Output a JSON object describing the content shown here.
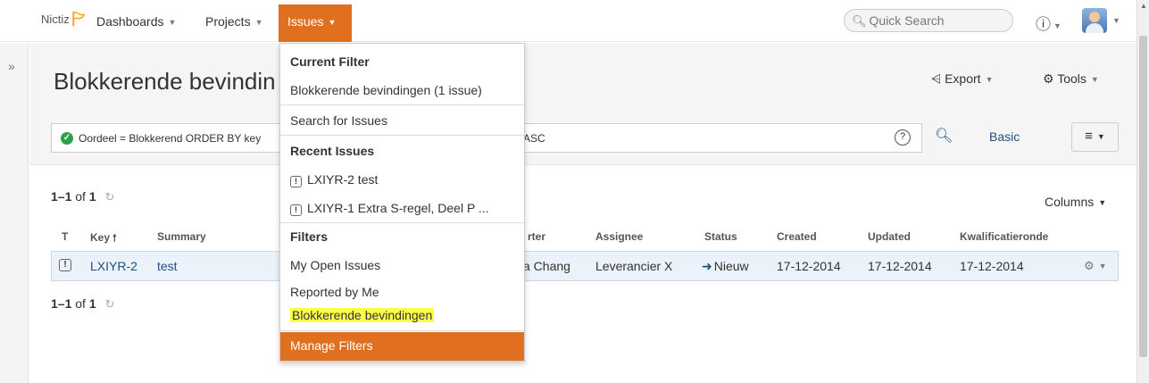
{
  "topbar": {
    "logo": "Nictiz",
    "nav": [
      {
        "label": "Dashboards"
      },
      {
        "label": "Projects"
      },
      {
        "label": "Issues"
      }
    ],
    "quick_search_placeholder": "Quick Search",
    "help_icon": "help-icon",
    "avatar_icon": "user-avatar"
  },
  "page": {
    "title": "Blokkerende bevindin",
    "export_label": "Export",
    "tools_label": "Tools"
  },
  "search": {
    "query_left": "Oordeel = Blokkerend ORDER BY key",
    "query_right": "ASC",
    "basic_label": "Basic"
  },
  "results": {
    "count_range": "1–1",
    "count_of": "of",
    "count_total": "1",
    "columns_label": "Columns",
    "headers": [
      "T",
      "Key",
      "Summary",
      "rter",
      "Assignee",
      "Status",
      "Created",
      "Updated",
      "Kwalificatieronde"
    ],
    "rows": [
      {
        "type": "!",
        "key": "LXIYR-2",
        "summary": "test",
        "reporter": "a Chang",
        "assignee": "Leverancier X",
        "status": "Nieuw",
        "created": "17-12-2014",
        "updated": "17-12-2014",
        "kwalificatieronde": "17-12-2014"
      }
    ]
  },
  "dropdown": {
    "current_filter_heading": "Current Filter",
    "current_filter_item": "Blokkerende bevindingen (1 issue)",
    "search_item": "Search for Issues",
    "recent_heading": "Recent Issues",
    "recent_items": [
      "LXIYR-2 test",
      "LXIYR-1 Extra S-regel, Deel P ..."
    ],
    "filters_heading": "Filters",
    "filter_items": [
      "My Open Issues",
      "Reported by Me",
      "Blokkerende bevindingen"
    ],
    "manage_filters": "Manage Filters"
  },
  "colors": {
    "accent": "#e07020",
    "link": "#205081",
    "highlight": "#ffff4a",
    "row_selected": "#ebf2f9"
  }
}
